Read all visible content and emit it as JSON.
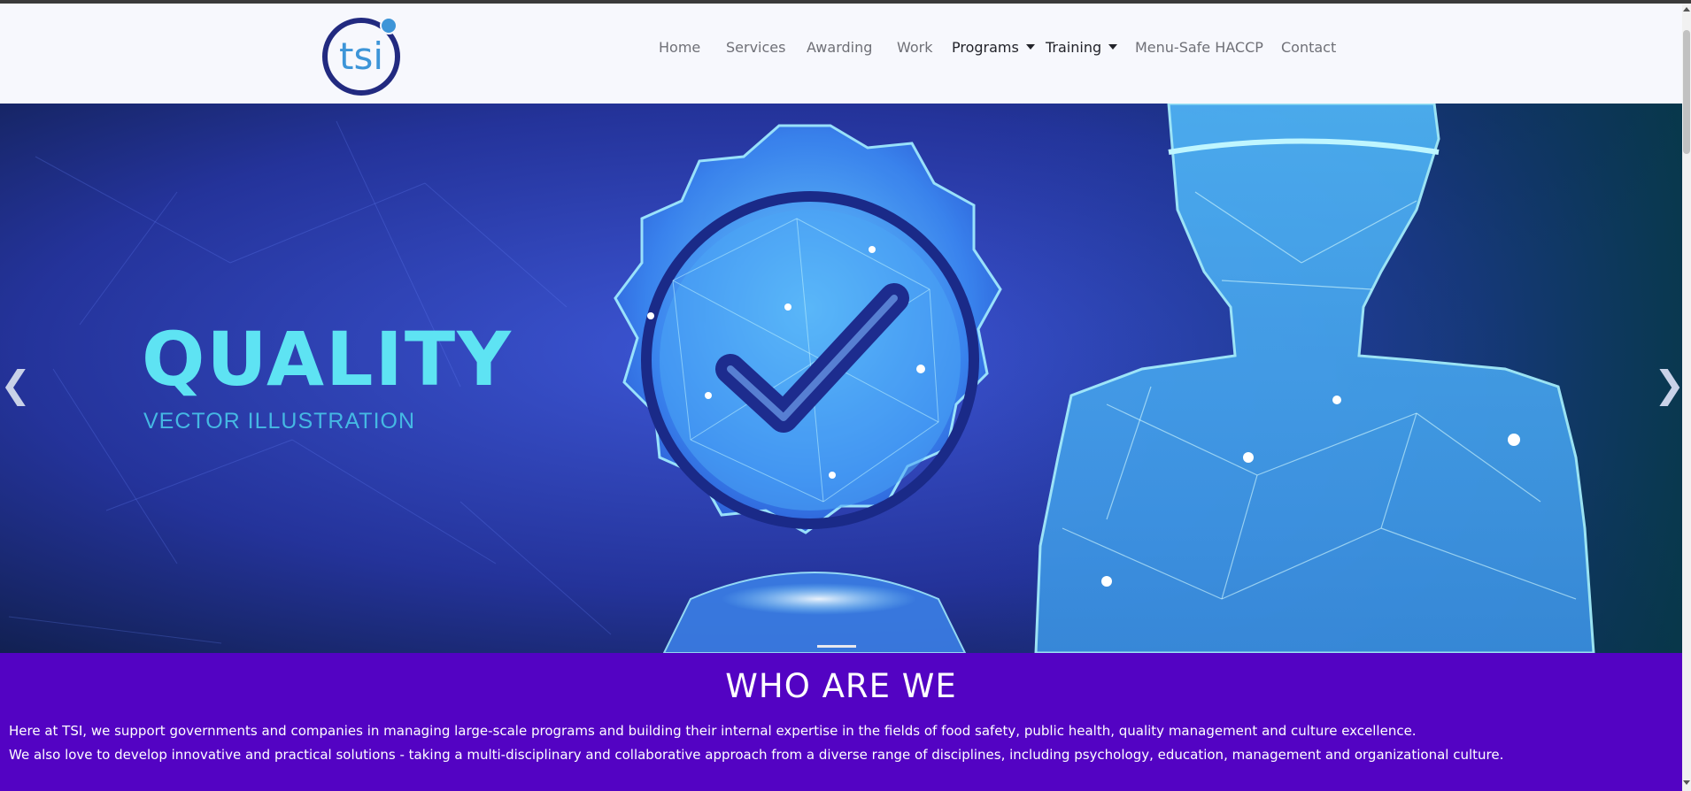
{
  "brand": {
    "logo_text": "tsi"
  },
  "nav": {
    "home": "Home",
    "services": "Services",
    "awarding": "Awarding",
    "work": "Work",
    "programs": "Programs",
    "training": "Training",
    "menu_safe": "Menu-Safe HACCP",
    "contact": "Contact"
  },
  "hero": {
    "title": "QUALITY",
    "subtitle": "VECTOR ILLUSTRATION",
    "prev_arrow": "❮",
    "next_arrow": "❯"
  },
  "about": {
    "heading": "WHO ARE WE",
    "paragraph1": "Here at TSI, we support governments and companies in managing large-scale programs and building their internal expertise in the fields of food safety, public health, quality management and culture excellence.",
    "paragraph2": "We also love to develop innovative and practical solutions - taking a multi-disciplinary and collaborative approach from a diverse range of disciplines, including psychology, education, management and organizational culture."
  },
  "colors": {
    "brand_purple": "#5303c3",
    "logo_navy": "#222a80",
    "logo_blue": "#3d95d8",
    "hero_cyan": "#5ee3f3"
  }
}
